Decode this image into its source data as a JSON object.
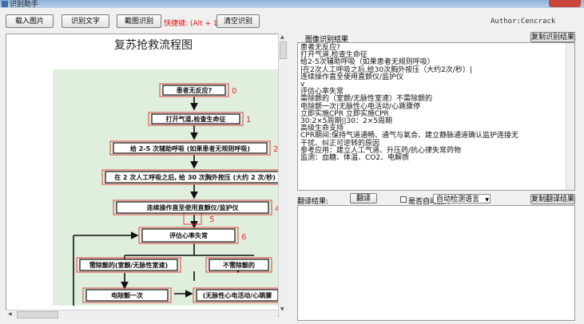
{
  "window": {
    "title": "识别助手"
  },
  "toolbar": {
    "load_image": "载入图片",
    "recognize_text": "识别文字",
    "screenshot_recognize": "截图识别",
    "hotkey_label": "快捷键",
    "hotkey": "(Alt + 1)",
    "clear_recognize": "清空识别",
    "author": "Author:Cencrack"
  },
  "ocr_panel": {
    "label": "图像识别结果",
    "copy_button": "复制识别结果",
    "text": "患者无反应?\n打开气道,检查生命征\n给2-5次辅助呼吸（如果患者无规则呼吸）\n|在2次人工呼吸之后,给30次胸外按压（大约2次/秒）|\n连续操作直至使用直颤仪/监护仪\nv\n评估心率失常\n需除颤的（室颤/无脉性室速）不需除颤的\n电除颤一次|无脉性心电活动/心跳骤停\n立即实施CPR 立即实施CPR\n30:2×5周期||30：2×5周期\n高级生命支持\nCPR期间:保持气道通畅、通气与氧合、建立静脉通道确认监护连接无\n干扰、纠正可逆转的原因\n参考应用：建立人工气道、升压药/抗心律失常药物\n监测：血糖、体温、CO2、电解质"
  },
  "translate_panel": {
    "label": "翻译结果:",
    "translate_button": "翻译",
    "auto_translate_label": "是否自动翻译",
    "language_select": "自动检测语言",
    "copy_button": "复制翻译结果"
  },
  "diagram": {
    "title": "复苏抢救流程图",
    "steps": [
      {
        "text": "患者无反应?",
        "number": "0"
      },
      {
        "text": "打开气道,检查生命征",
        "number": "1"
      },
      {
        "text": "给 2-5 次辅助呼吸 (如果患者无规则呼吸)",
        "number": "2"
      },
      {
        "text": "在 2 次人工呼吸之后, 给 30 次胸外按压 (大约 2 次/秒)",
        "number": "3"
      },
      {
        "text": "连续操作直至使用直颤仪/监护仪",
        "number": "4"
      },
      {
        "text": "",
        "number": "5"
      },
      {
        "text": "评估心率失常",
        "number": "6"
      }
    ],
    "branch_left": "需除颤的(室颤/无脉性室速)",
    "branch_right": "不需除颤的",
    "defib": "电除颤一次",
    "pea": "(无脉性心电活动/心跳骤"
  },
  "colors": {
    "diagram_bg": "#dfeedd",
    "step_border": "#e04040",
    "number_color": "#e03030"
  }
}
